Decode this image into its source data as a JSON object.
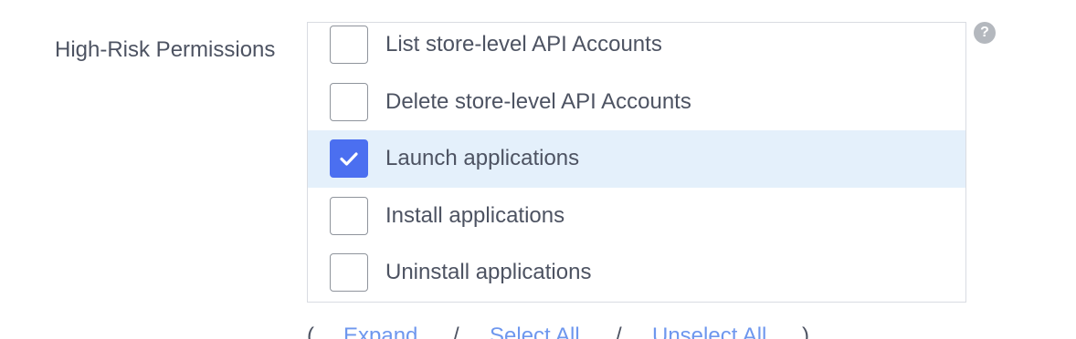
{
  "field": {
    "label": "High-Risk Permissions"
  },
  "permissions": [
    {
      "label": "List store-level API Accounts",
      "checked": false,
      "selected": false
    },
    {
      "label": "Delete store-level API Accounts",
      "checked": false,
      "selected": false
    },
    {
      "label": "Launch applications",
      "checked": true,
      "selected": true
    },
    {
      "label": "Install applications",
      "checked": false,
      "selected": false
    },
    {
      "label": "Uninstall applications",
      "checked": false,
      "selected": false
    }
  ],
  "help": {
    "icon": "question-circle-icon",
    "glyph": "?"
  },
  "actions": {
    "open_paren": "(",
    "expand": "Expand",
    "separator1": "/",
    "select_all": "Select All",
    "separator2": "/",
    "unselect_all": "Unselect All",
    "close_paren": ")"
  },
  "colors": {
    "accent": "#4b6ff0",
    "selected_row": "#e4f0fb",
    "link": "#6e97ee",
    "text": "#4d5362"
  }
}
